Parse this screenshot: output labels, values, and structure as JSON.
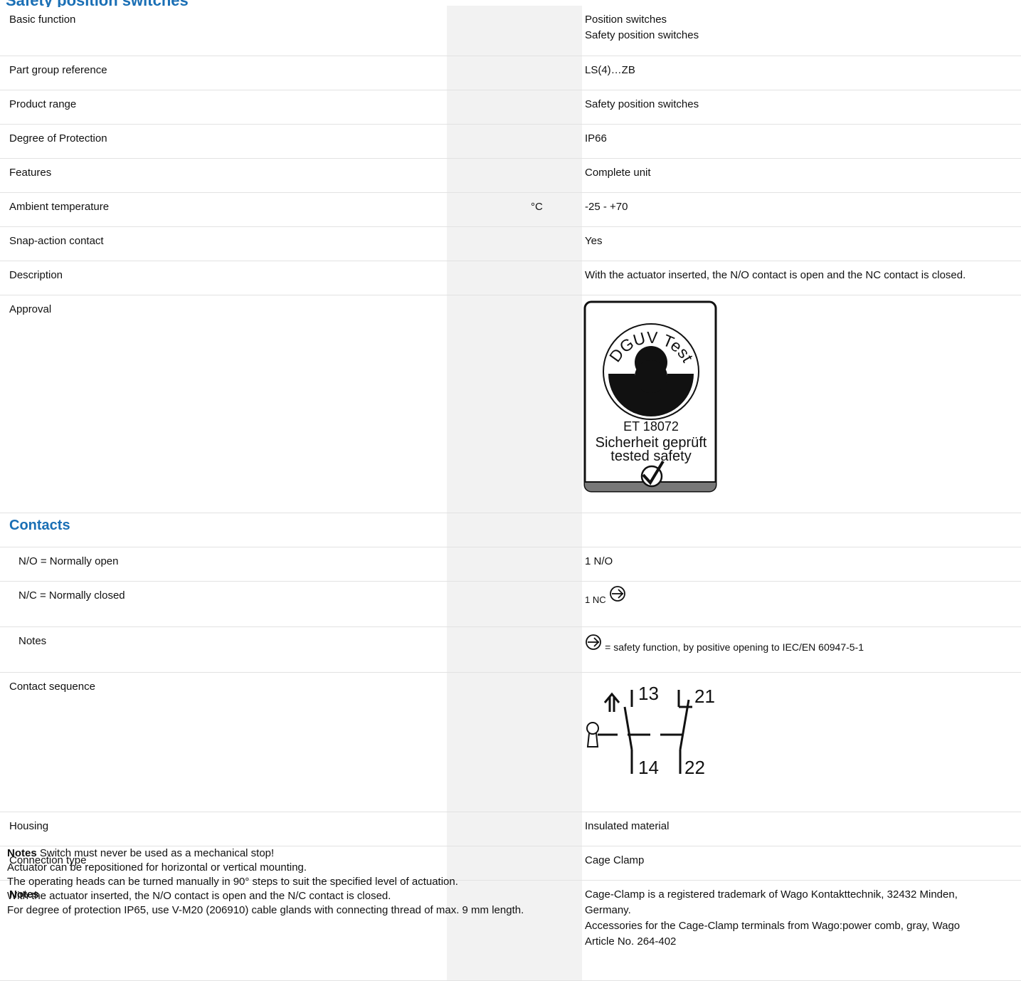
{
  "section_heading": "Safety position switches",
  "rows": [
    {
      "label": "Basic function",
      "value_lines": [
        "Position switches",
        "Safety position switches"
      ]
    },
    {
      "label": "Part group reference",
      "value": "LS(4)…ZB"
    },
    {
      "label": "Product range",
      "value": "Safety position switches"
    },
    {
      "label": "Degree of Protection",
      "value": "IP66"
    },
    {
      "label": "Features",
      "value": "Complete unit"
    },
    {
      "label": "Ambient temperature",
      "unit": "°C",
      "value": "-25 - +70"
    },
    {
      "label": "Snap-action contact",
      "value": "Yes"
    },
    {
      "label": "Description",
      "value": "With the actuator inserted, the N/O contact is open and the NC contact is closed."
    },
    {
      "label": "Approval"
    }
  ],
  "approval_badge": {
    "arc_text": "DGUV Test",
    "number": "ET 18072",
    "line1": "Sicherheit geprüft",
    "line2": "tested safety"
  },
  "contacts": {
    "title": "Contacts",
    "no_label": "N/O = Normally open",
    "no_value": "1 N/O",
    "nc_label": "N/C = Normally closed",
    "nc_value": "1 NC",
    "notes_label": "Notes",
    "notes_value": "= safety function, by positive opening to IEC/EN 60947-5-1"
  },
  "contact_sequence": {
    "label": "Contact sequence",
    "terminals": [
      "13",
      "14",
      "21",
      "22"
    ]
  },
  "rows2": [
    {
      "label": "Housing",
      "value": "Insulated material"
    },
    {
      "label": "Connection type",
      "value": "Cage Clamp"
    }
  ],
  "notes_row": {
    "label": "Notes",
    "value_lines": [
      "Cage-Clamp is a registered trademark of Wago Kontakttechnik, 32432 Minden,",
      "Germany.",
      "Accessories for the Cage-Clamp terminals from Wago:power comb, gray, Wago",
      "Article No. 264-402"
    ]
  },
  "footer_notes": {
    "label": "Notes",
    "first": "Switch must never be used as a mechanical stop!",
    "lines": [
      "Actuator can be repositioned for horizontal or vertical mounting.",
      "The operating heads can be turned manually in 90° steps to suit the specified level of actuation.",
      "With the actuator inserted, the N/O contact is open and the N/C contact is closed.",
      "For degree of protection IP65, use V-M20 (206910) cable glands with connecting thread of max. 9 mm length."
    ]
  }
}
